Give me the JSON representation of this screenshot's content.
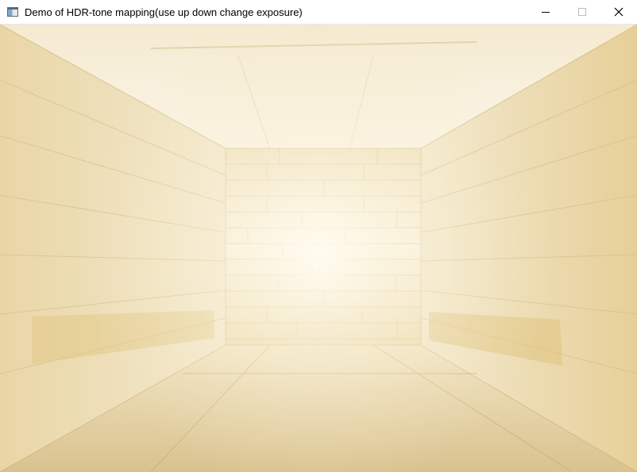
{
  "window": {
    "title": "Demo of HDR-tone mapping(use up down change exposure)",
    "icon": "app-window-icon",
    "controls": [
      "minimize-icon",
      "maximize-icon",
      "close-icon"
    ]
  },
  "scene": {
    "description_icon": "wooden-room-render",
    "colors": {
      "wood_light": "#f4ecd2",
      "wood_mid": "#e6d3a0",
      "wood_dark": "#cdb070",
      "glow": "#fffbef"
    }
  }
}
